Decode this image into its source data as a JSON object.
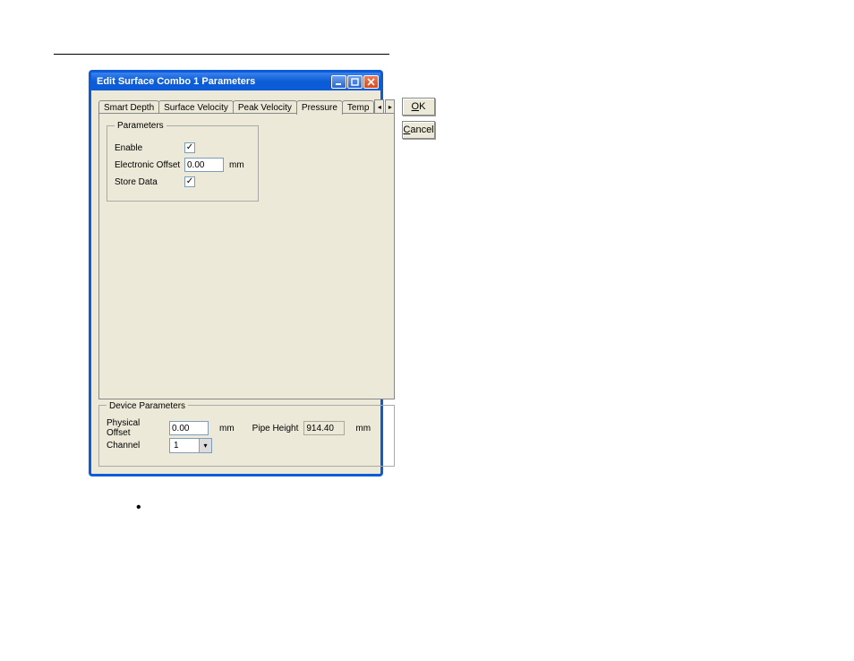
{
  "dialog": {
    "title": "Edit Surface Combo 1 Parameters",
    "tabs": {
      "smart_depth": "Smart Depth",
      "surface_velocity": "Surface Velocity",
      "peak_velocity": "Peak Velocity",
      "pressure": "Pressure",
      "temp": "Temp"
    },
    "buttons": {
      "ok": "OK",
      "cancel": "Cancel"
    },
    "parameters_group": {
      "legend": "Parameters",
      "enable_label": "Enable",
      "electronic_offset_label": "Electronic Offset",
      "electronic_offset_value": "0.00",
      "electronic_offset_unit": "mm",
      "store_data_label": "Store Data"
    },
    "device_group": {
      "legend": "Device Parameters",
      "physical_offset_label": "Physical Offset",
      "physical_offset_value": "0.00",
      "physical_offset_unit": "mm",
      "pipe_height_label": "Pipe Height",
      "pipe_height_value": "914.40",
      "pipe_height_unit": "mm",
      "channel_label": "Channel",
      "channel_value": "1"
    }
  }
}
